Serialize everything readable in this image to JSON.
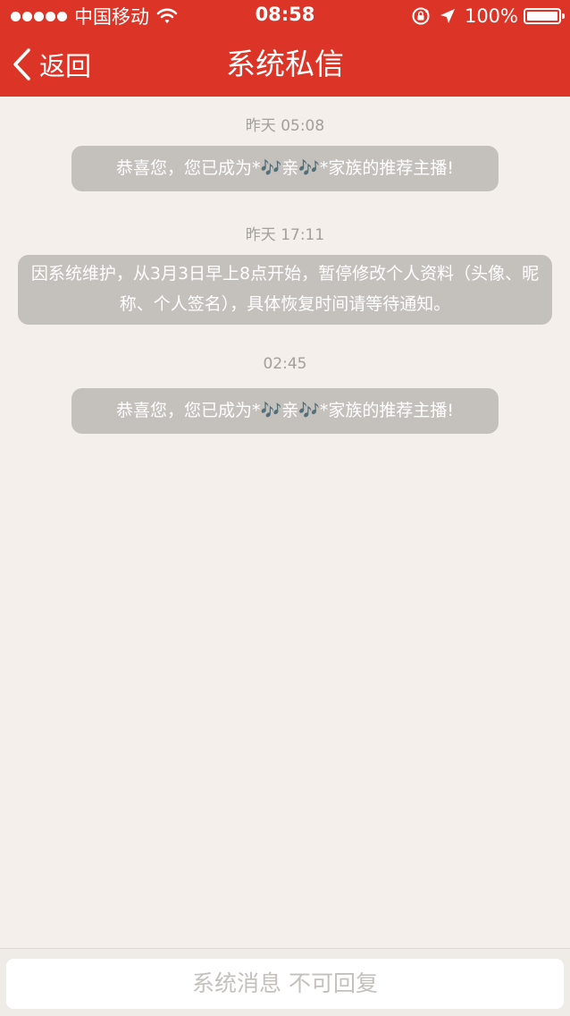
{
  "status_bar": {
    "carrier": "中国移动",
    "time": "08:58",
    "battery_percent": "100%",
    "battery_level": 1.0
  },
  "nav": {
    "back_label": "返回",
    "title": "系统私信"
  },
  "messages": [
    {
      "time": "昨天 05:08",
      "text": "恭喜您，您已成为*🎶亲🎶*家族的推荐主播!"
    },
    {
      "time": "昨天 17:11",
      "text": "因系统维护，从3月3日早上8点开始，暂停修改个人资料（头像、昵称、个人签名），具体恢复时间请等待通知。"
    },
    {
      "time": "02:45",
      "text": "恭喜您，您已成为*🎶亲🎶*家族的推荐主播!"
    }
  ],
  "footer": {
    "reply_placeholder": "系统消息 不可回复"
  },
  "colors": {
    "header_red": "#dc3427",
    "background": "#f4efeb",
    "bubble_gray": "#c4c1bc",
    "timestamp_gray": "#a3a09c"
  },
  "icons": [
    "wifi-icon",
    "rotation-lock-icon",
    "location-arrow-icon",
    "battery-icon",
    "chevron-left-icon"
  ]
}
